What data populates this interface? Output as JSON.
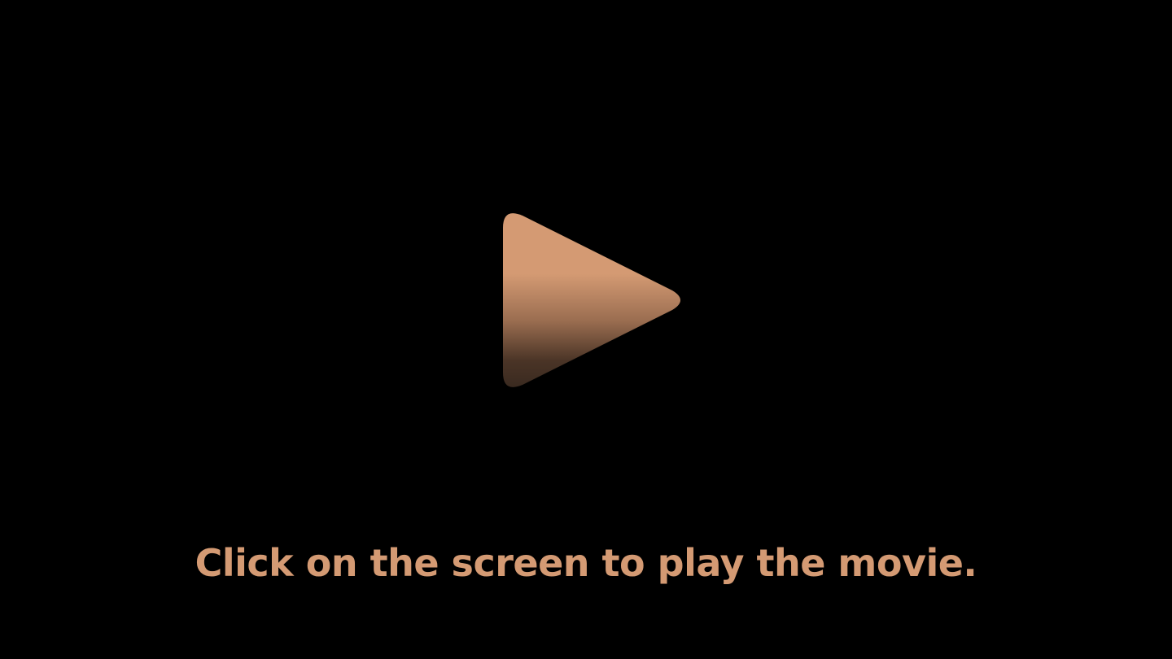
{
  "player": {
    "prompt_text": "Click on the screen to play the movie.",
    "play_icon": "play-triangle-icon",
    "colors": {
      "background": "#000000",
      "accent": "#d49a73",
      "gradient_top": "#d49a73",
      "gradient_bottom": "#3a2a20"
    }
  }
}
